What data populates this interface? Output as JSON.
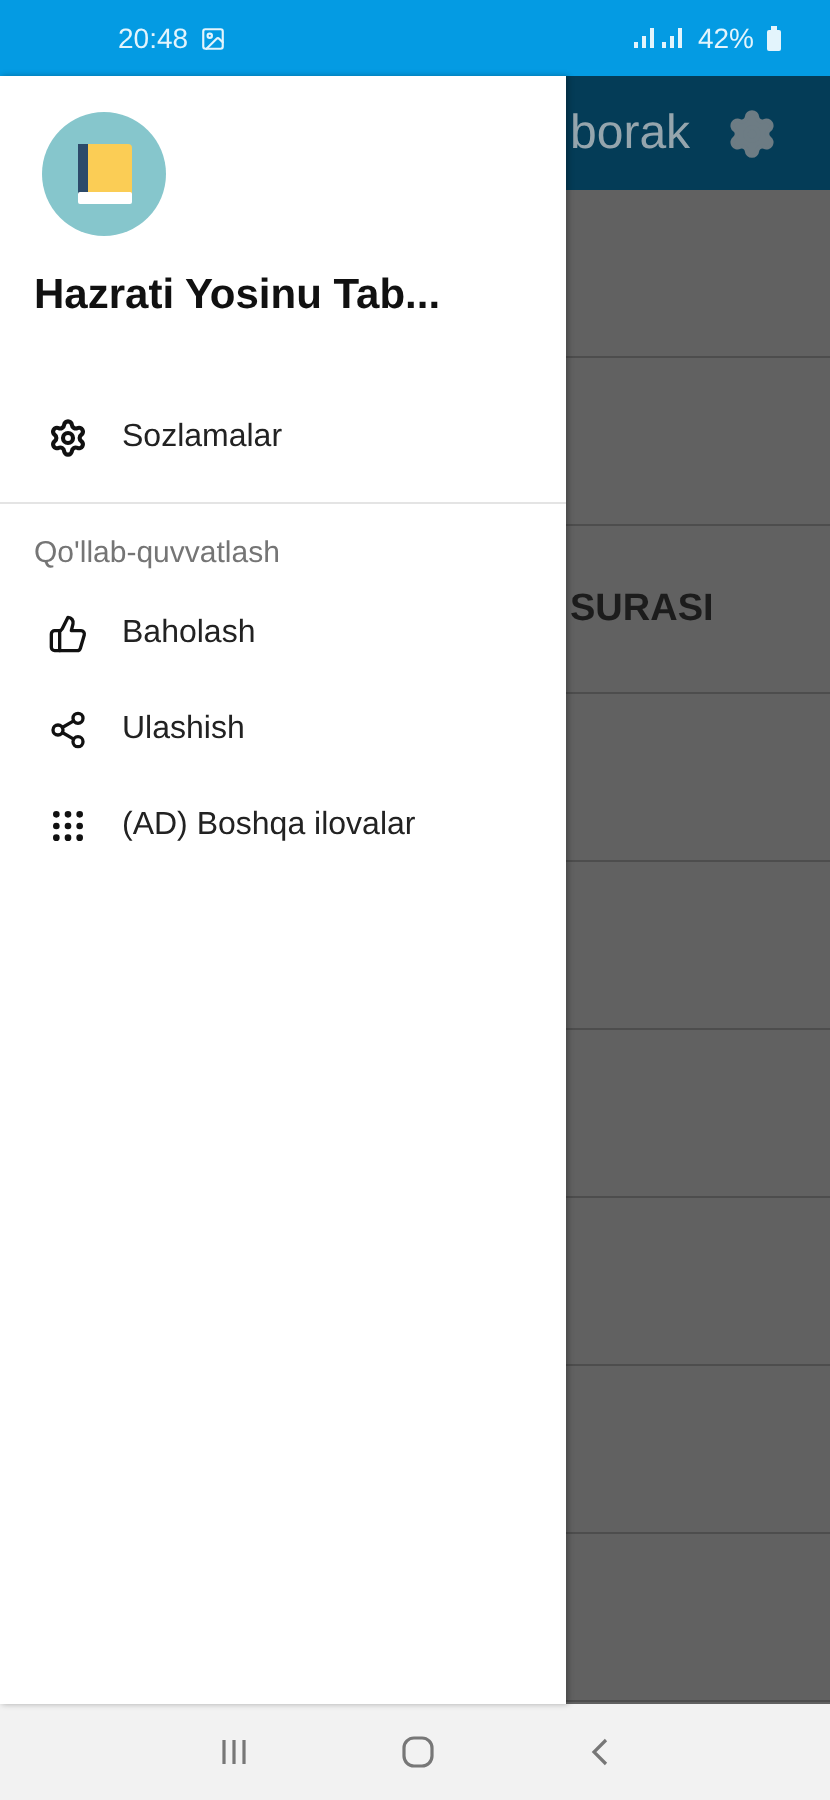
{
  "status_bar": {
    "time": "20:48",
    "battery": "42%"
  },
  "drawer": {
    "app_title": "Hazrati Yosinu Tab...",
    "items": [
      {
        "kind": "settings",
        "label": "Sozlamalar"
      }
    ],
    "section": {
      "header": "Qo'llab-quvvatlash",
      "items": [
        {
          "kind": "rate",
          "label": "Baholash"
        },
        {
          "kind": "share",
          "label": "Ulashish"
        },
        {
          "kind": "apps",
          "label": "(AD) Boshqa ilovalar"
        }
      ]
    }
  },
  "background": {
    "title": "borak",
    "rows": [
      {},
      {},
      {
        "text": "SURASI"
      },
      {},
      {},
      {},
      {},
      {},
      {}
    ]
  }
}
